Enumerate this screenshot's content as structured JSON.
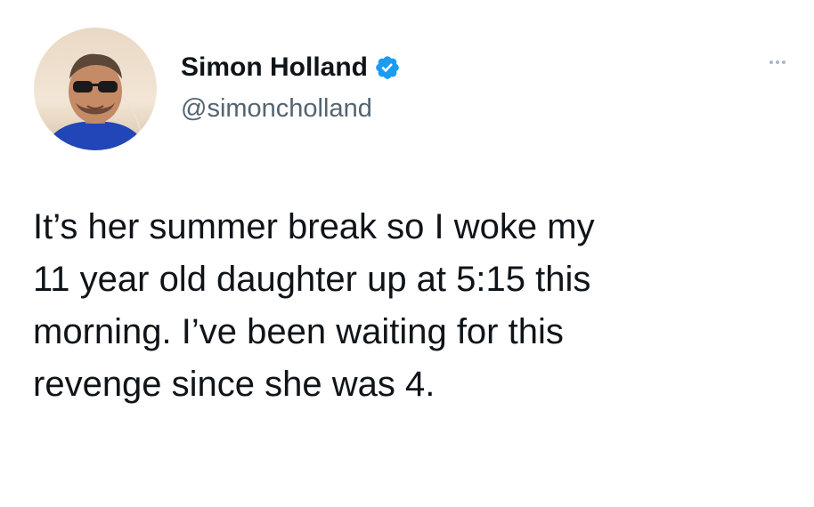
{
  "author": {
    "display_name": "Simon Holland",
    "handle": "@simoncholland",
    "verified": true,
    "avatar_icon": "avatar-photo"
  },
  "tweet": {
    "lines": [
      "It’s her summer break so I woke my",
      "11 year old daughter up at 5:15 this",
      "morning. I’ve been waiting for this",
      "revenge since she was 4."
    ]
  },
  "menu": {
    "icon": "more-options-icon"
  },
  "colors": {
    "text": "#0f1419",
    "secondary": "#536471",
    "verified": "#1d9bf0",
    "dots": "#aab8c2"
  }
}
